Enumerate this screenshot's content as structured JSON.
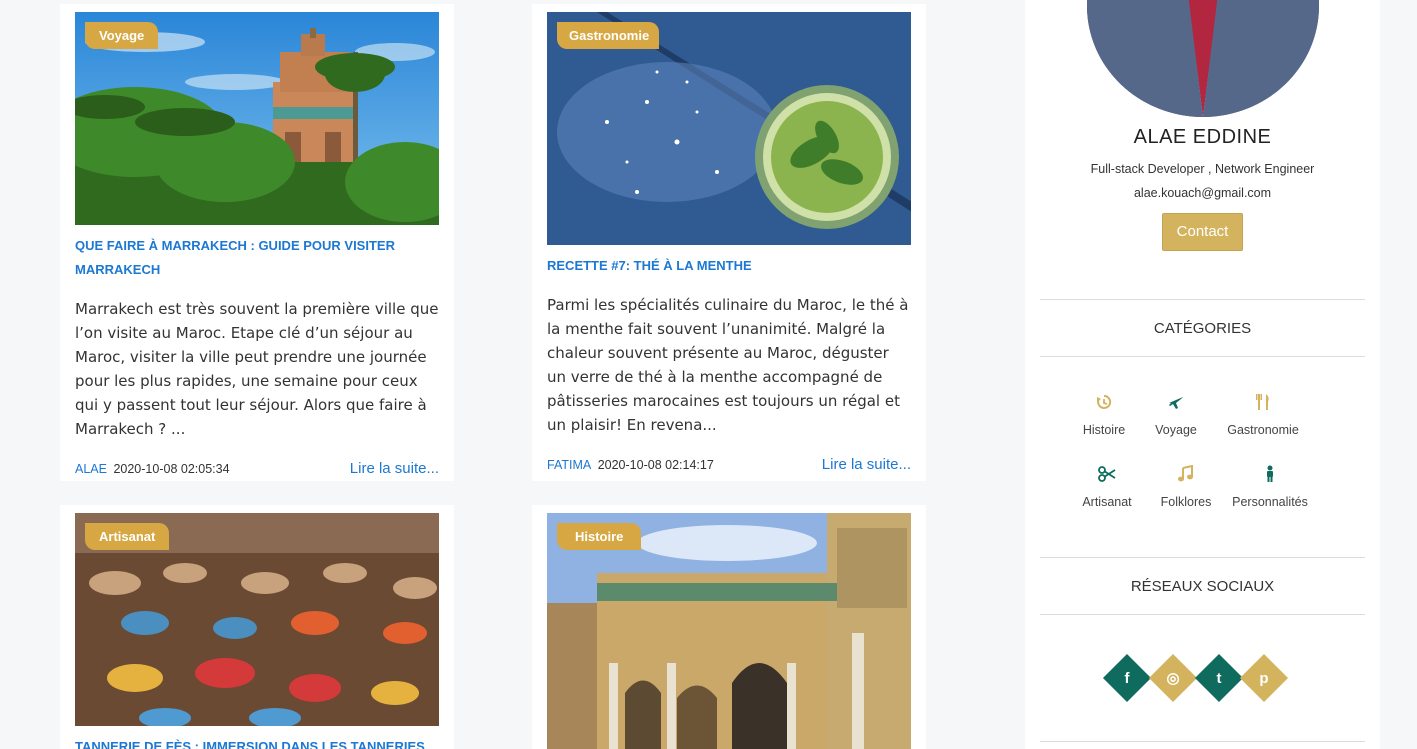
{
  "posts": [
    {
      "category": "Voyage",
      "title": "QUE FAIRE À MARRAKECH : GUIDE POUR VISITER MARRAKECH",
      "excerpt": "Marrakech est très souvent la première ville que l’on visite au Maroc. Etape clé d’un séjour au Maroc, visiter la ville peut prendre une journée pour les plus rapides, une semaine pour ceux qui y passent tout leur séjour. Alors que faire à Marrakech ? ...",
      "author": "ALAE",
      "date": "2020-10-08 02:05:34",
      "read_more": "Lire la suite..."
    },
    {
      "category": "Gastronomie",
      "title": "RECETTE #7: THÉ À LA MENTHE",
      "excerpt": "Parmi les spécialités culinaire du Maroc, le thé à la menthe fait souvent l’unanimité. Malgré la chaleur souvent présente au Maroc, déguster un verre de thé à la menthe accompagné de pâtisseries marocaines est toujours un régal et un plaisir! En revena...",
      "author": "FATIMA",
      "date": "2020-10-08 02:14:17",
      "read_more": "Lire la suite..."
    },
    {
      "category": "Artisanat",
      "title": "TANNERIE DE FÈS : IMMERSION DANS LES TANNERIES"
    },
    {
      "category": "Histoire"
    }
  ],
  "profile": {
    "name": "ALAE EDDINE",
    "role": "Full-stack Developer , Network Engineer",
    "email": "alae.kouach@gmail.com",
    "contact_label": "Contact"
  },
  "categories_section": {
    "title": "CATÉGORIES",
    "items": [
      {
        "label": "Histoire",
        "icon": "history-icon"
      },
      {
        "label": "Voyage",
        "icon": "plane-icon"
      },
      {
        "label": "Gastronomie",
        "icon": "utensils-icon"
      },
      {
        "label": "Artisanat",
        "icon": "scissors-icon"
      },
      {
        "label": "Folklores",
        "icon": "music-icon"
      },
      {
        "label": "Personnalités",
        "icon": "person-icon"
      }
    ]
  },
  "social_section": {
    "title": "RÉSEAUX SOCIAUX",
    "links": [
      {
        "label": "f",
        "icon": "facebook-icon",
        "color": "#0e6b5d"
      },
      {
        "label": "◎",
        "icon": "instagram-icon",
        "color": "#d3b35e"
      },
      {
        "label": "t",
        "icon": "twitter-icon",
        "color": "#0e6b5d"
      },
      {
        "label": "p",
        "icon": "pinterest-icon",
        "color": "#d3b35e"
      }
    ]
  },
  "colors": {
    "accent_gold": "#d3b35e",
    "tag_orange": "#d6a743",
    "link_blue": "#1c78d3",
    "icon_teal": "#0e6b5d"
  }
}
